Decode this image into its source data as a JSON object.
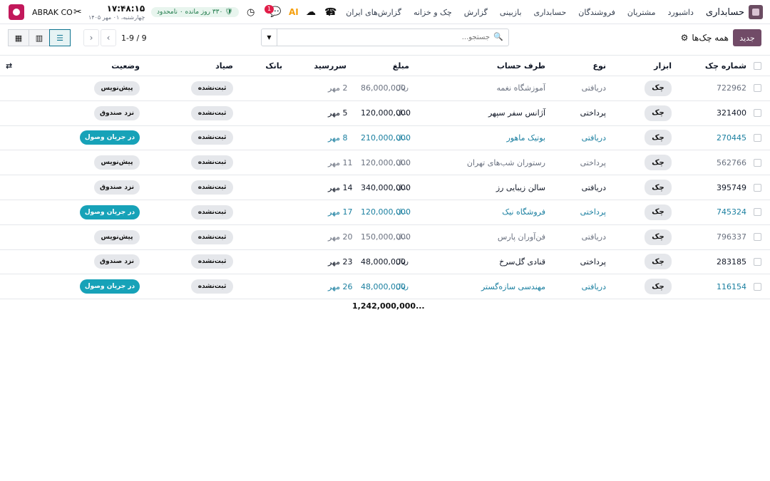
{
  "app": {
    "brand": "حسابداری",
    "nav": [
      "داشبورد",
      "مشتریان",
      "فروشندگان",
      "حسابداری",
      "بازبینی",
      "گزارش",
      "چک و خزانه",
      "گزارش‌های ایران"
    ],
    "plus": "+"
  },
  "system": {
    "company": "ABRAK CO",
    "time": "۱۷:۴۸:۱۵",
    "date": "چهارشنبه، ۰۱ مهر ۱۴۰۵",
    "subscription": "۳۳۰ روز مانده ۰ نامحدود",
    "chat_badge": "1",
    "ai_label": "AI"
  },
  "control": {
    "new_label": "جدید",
    "title": "همه چک‌ها",
    "search_placeholder": "جستجو...",
    "pager": "1-9 / 9"
  },
  "columns": {
    "num": "شماره چک",
    "tool": "ابزار",
    "type": "نوع",
    "party": "طرف حساب",
    "amount": "مبلغ",
    "due": "سررسید",
    "bank": "بانک",
    "sayad": "صیاد",
    "status": "وضعیت"
  },
  "rows": [
    {
      "num": "722962",
      "tool": "چک",
      "type": "دریافتی",
      "party": "آموزشگاه نغمه",
      "amount": "86,000,000",
      "currency": "ریال",
      "due": "2 مهر",
      "sayad": "ثبت‌نشده",
      "status": "پیش‌نویس",
      "status_kind": "draft",
      "tone": "muted"
    },
    {
      "num": "321400",
      "tool": "چک",
      "type": "پرداختی",
      "party": "آژانس سفر سپهر",
      "amount": "120,000,000",
      "currency": "...ل",
      "due": "5 مهر",
      "sayad": "ثبت‌نشده",
      "status": "نزد صندوق",
      "status_kind": "cash",
      "tone": "dark"
    },
    {
      "num": "270445",
      "tool": "چک",
      "type": "دریافتی",
      "party": "بوتیک ماهور",
      "amount": "210,000,000",
      "currency": "...ل",
      "due": "8 مهر",
      "sayad": "ثبت‌نشده",
      "status": "در جریان وصول",
      "status_kind": "transit",
      "tone": "link"
    },
    {
      "num": "562766",
      "tool": "چک",
      "type": "پرداختی",
      "party": "رستوران شب‌های تهران",
      "amount": "120,000,000",
      "currency": "...ل",
      "due": "11 مهر",
      "sayad": "ثبت‌نشده",
      "status": "پیش‌نویس",
      "status_kind": "draft",
      "tone": "muted"
    },
    {
      "num": "395749",
      "tool": "چک",
      "type": "دریافتی",
      "party": "سالن زیبایی رز",
      "amount": "340,000,000",
      "currency": "...ل",
      "due": "14 مهر",
      "sayad": "ثبت‌نشده",
      "status": "نزد صندوق",
      "status_kind": "cash",
      "tone": "dark"
    },
    {
      "num": "745324",
      "tool": "چک",
      "type": "پرداختی",
      "party": "فروشگاه نیک",
      "amount": "120,000,000",
      "currency": "...ل",
      "due": "17 مهر",
      "sayad": "ثبت‌نشده",
      "status": "در جریان وصول",
      "status_kind": "transit",
      "tone": "link"
    },
    {
      "num": "796337",
      "tool": "چک",
      "type": "دریافتی",
      "party": "فن‌آوران پارس",
      "amount": "150,000,000",
      "currency": "...ل",
      "due": "20 مهر",
      "sayad": "ثبت‌نشده",
      "status": "پیش‌نویس",
      "status_kind": "draft",
      "tone": "muted"
    },
    {
      "num": "283185",
      "tool": "چک",
      "type": "پرداختی",
      "party": "قنادی گل‌سرخ",
      "amount": "48,000,000",
      "currency": "ریال",
      "due": "23 مهر",
      "sayad": "ثبت‌نشده",
      "status": "نزد صندوق",
      "status_kind": "cash",
      "tone": "dark"
    },
    {
      "num": "116154",
      "tool": "چک",
      "type": "دریافتی",
      "party": "مهندسی سازه‌گستر",
      "amount": "48,000,000",
      "currency": "ریال",
      "due": "26 مهر",
      "sayad": "ثبت‌نشده",
      "status": "در جریان وصول",
      "status_kind": "transit",
      "tone": "link"
    }
  ],
  "total": "1,242,000,000...",
  "icons": {
    "app": "app-grid-icon",
    "tools": "tools-icon",
    "timer": "timer-icon",
    "chat": "chat-icon",
    "cloud": "cloud-icon",
    "phone": "phone-icon",
    "settings": "column-settings-icon"
  }
}
